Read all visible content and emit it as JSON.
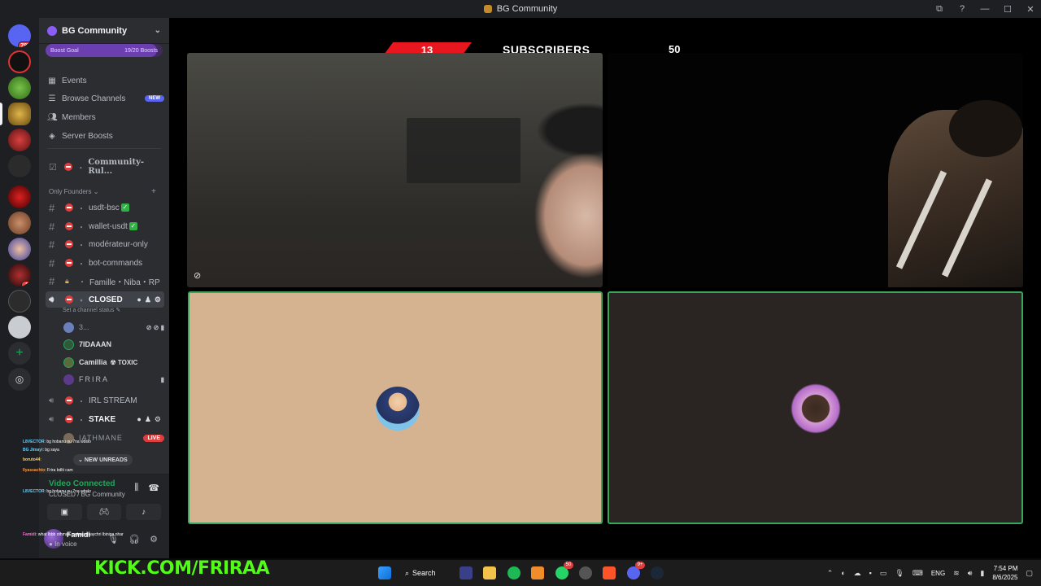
{
  "window": {
    "title": "BG Community",
    "controls": [
      "⧉",
      "?",
      "—",
      "☐",
      "✕"
    ]
  },
  "rail": {
    "dm_badge": "797",
    "badge_1": "1"
  },
  "sidebar": {
    "server_name": "BG Community",
    "boost_goal": {
      "label": "Boost Goal",
      "progress_text": "19/20 Boosts",
      "progress": 0.95
    },
    "menu": [
      {
        "label": "Events",
        "icon": "calendar-icon"
      },
      {
        "label": "Browse Channels",
        "icon": "browse-channels-icon",
        "tag": "NEW"
      },
      {
        "label": "Members",
        "icon": "members-icon"
      },
      {
        "label": "Server Boosts",
        "icon": "boost-icon"
      }
    ],
    "rules_channel": "Community-Rul...",
    "category": "Only Founders",
    "text_channels": [
      "usdt-bsc",
      "wallet-usdt",
      "modérateur-only",
      "bot-commands",
      "Famille・Niba・RP"
    ],
    "voice_closed": {
      "name": "CLOSED",
      "status_hint": "Set a channel status",
      "members": [
        {
          "name": "3..."
        },
        {
          "name": "7IDAAAN"
        },
        {
          "name": "Camillia",
          "tag": "TOXIC"
        },
        {
          "name": "FRIRA"
        }
      ]
    },
    "voice_irl": {
      "name": "IRL STREAM"
    },
    "voice_stake": {
      "name": "STAKE"
    },
    "stake_member": {
      "name": "IATHMANE",
      "badge": "LIVE"
    },
    "new_unreads": "NEW UNREADS"
  },
  "chat_overlay": [
    {
      "user": "L8VECTOR",
      "msg": ": bg hobanu ou 7na wbslo"
    },
    {
      "user": "BG Jimayi",
      "msg": ": bg saya"
    },
    {
      "user": "boruto44",
      "msg": ":"
    },
    {
      "user": "Ilyassachto",
      "msg": ": Frira bdlti cam"
    },
    {
      "user": "L8VECTOR",
      "msg": ": bg hobanu ou 7na wbslo"
    },
    {
      "user": "Famidi",
      "msg": ": what lbbb othman cadeau ghaychri lbiniga nhar"
    }
  ],
  "voice_panel": {
    "status": "Video Connected",
    "channel": "CLOSED / BG Community"
  },
  "user_panel": {
    "name": "Famidi",
    "status": "In voice"
  },
  "stream": {
    "subs_count": "13",
    "subs_label": "SUBSCRIBERS",
    "subs_goal": "50",
    "watermark": "KICK.COM/FRIRAA"
  },
  "taskbar": {
    "search": "Search",
    "lang": "ENG",
    "time": "7:54 PM",
    "date": "8/6/2025",
    "whatsapp_badge": "50",
    "discord_badge": "9+"
  }
}
